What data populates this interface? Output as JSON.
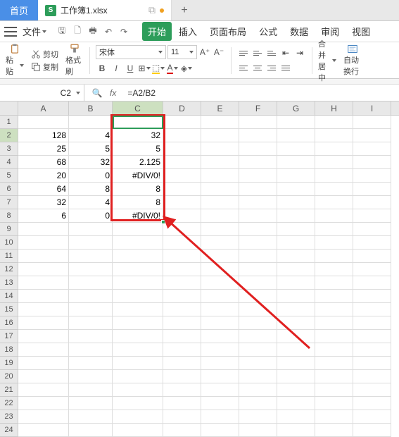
{
  "tabs": {
    "home_label": "首页",
    "file_label": "工作簿1.xlsx"
  },
  "menu": {
    "file_label": "文件",
    "items": [
      "开始",
      "插入",
      "页面布局",
      "公式",
      "数据",
      "审阅",
      "视图"
    ]
  },
  "ribbon": {
    "paste_label": "粘贴",
    "cut_label": "剪切",
    "copy_label": "复制",
    "format_painter_label": "格式刷",
    "font_name": "宋体",
    "font_size": "11",
    "merge_label": "合并居中",
    "wrap_label": "自动换行"
  },
  "formula_bar": {
    "cell_ref": "C2",
    "fx_label": "fx",
    "formula": "=A2/B2"
  },
  "columns": [
    "A",
    "B",
    "C",
    "D",
    "E",
    "F",
    "G",
    "H",
    "I"
  ],
  "col_widths": [
    "colw-A",
    "colw-B",
    "colw-C",
    "colw-D",
    "colw-E",
    "colw-F",
    "colw-G",
    "colw-H",
    "colw-I"
  ],
  "active_col_index": 2,
  "row_count": 24,
  "active_row": 2,
  "cells": {
    "r2": {
      "A": "128",
      "B": "4",
      "C": "32"
    },
    "r3": {
      "A": "25",
      "B": "5",
      "C": "5"
    },
    "r4": {
      "A": "68",
      "B": "32",
      "C": "2.125"
    },
    "r5": {
      "A": "20",
      "B": "0",
      "C": "#DIV/0!"
    },
    "r6": {
      "A": "64",
      "B": "8",
      "C": "8"
    },
    "r7": {
      "A": "32",
      "B": "4",
      "C": "8"
    },
    "r8": {
      "A": "6",
      "B": "0",
      "C": "#DIV/0!"
    }
  }
}
